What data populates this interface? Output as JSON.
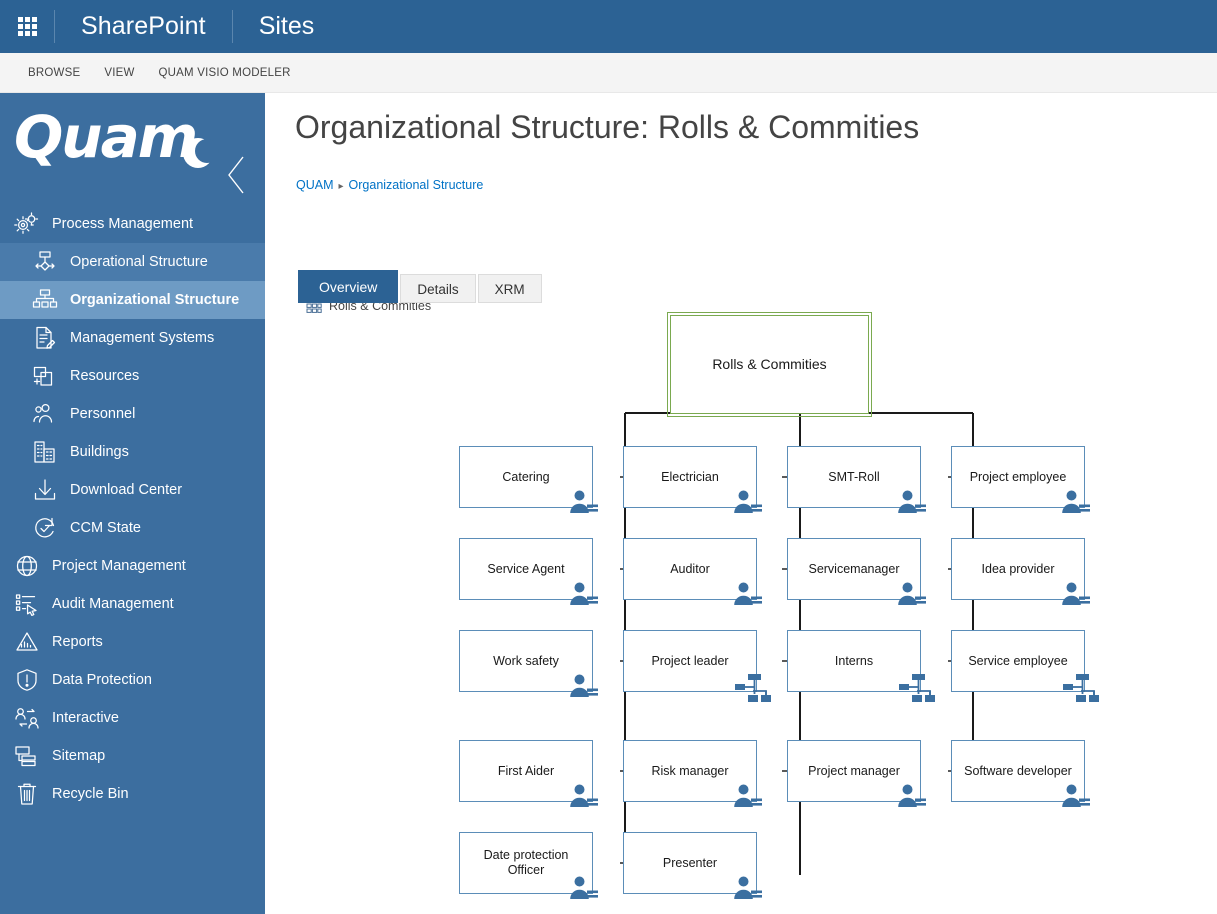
{
  "suitebar": {
    "waffle_icon": "app-launcher-icon",
    "brand": "SharePoint",
    "site": "Sites"
  },
  "ribbon": {
    "tabs": [
      {
        "label": "BROWSE"
      },
      {
        "label": "VIEW"
      },
      {
        "label": "QUAM VISIO MODELER"
      }
    ]
  },
  "sidebar": {
    "logo_text": "Quam",
    "logo_icon": "quam-moon-logo-icon",
    "collapse_icon": "chevron-left-icon",
    "items": [
      {
        "label": "Process Management",
        "icon": "gears-icon",
        "level": "top",
        "state": "normal"
      },
      {
        "label": "Operational Structure",
        "icon": "flow-chart-icon",
        "level": "sub",
        "state": "active-soft"
      },
      {
        "label": "Organizational Structure",
        "icon": "org-chart-icon",
        "level": "sub",
        "state": "active-strong"
      },
      {
        "label": "Management Systems",
        "icon": "document-edit-icon",
        "level": "sub",
        "state": "normal"
      },
      {
        "label": "Resources",
        "icon": "resources-icon",
        "level": "sub",
        "state": "normal"
      },
      {
        "label": "Personnel",
        "icon": "people-icon",
        "level": "sub",
        "state": "normal"
      },
      {
        "label": "Buildings",
        "icon": "building-icon",
        "level": "sub",
        "state": "normal"
      },
      {
        "label": "Download Center",
        "icon": "download-icon",
        "level": "sub",
        "state": "normal"
      },
      {
        "label": "CCM State",
        "icon": "check-cycle-icon",
        "level": "sub",
        "state": "normal"
      },
      {
        "label": "Project Management",
        "icon": "globe-icon",
        "level": "top",
        "state": "normal"
      },
      {
        "label": "Audit Management",
        "icon": "checklist-cursor-icon",
        "level": "top",
        "state": "normal"
      },
      {
        "label": "Reports",
        "icon": "chart-mountain-icon",
        "level": "top",
        "state": "normal"
      },
      {
        "label": "Data Protection",
        "icon": "shield-alert-icon",
        "level": "top",
        "state": "normal"
      },
      {
        "label": "Interactive",
        "icon": "people-exchange-icon",
        "level": "top",
        "state": "normal"
      },
      {
        "label": "Sitemap",
        "icon": "sitemap-icon",
        "level": "top",
        "state": "normal"
      },
      {
        "label": "Recycle Bin",
        "icon": "trash-icon",
        "level": "top",
        "state": "normal"
      }
    ]
  },
  "main": {
    "page_title": "Organizational Structure: Rolls & Commities",
    "breadcrumb": {
      "root": "QUAM",
      "separator": "▸",
      "parent": "Organizational Structure",
      "leaf": "Rolls & Commities",
      "leaf_icon": "org-chart-small-icon"
    },
    "tabs": [
      {
        "label": "Overview",
        "selected": true
      },
      {
        "label": "Details",
        "selected": false
      },
      {
        "label": "XRM",
        "selected": false
      }
    ]
  },
  "chart_data": {
    "type": "diagram",
    "title": "Rolls & Commities",
    "root": {
      "label": "Rolls & Commities",
      "border_color": "#7aa94f"
    },
    "node_border_color": "#5b8db8",
    "connector_color": "#1a1a1a",
    "badge_color": "#3b6fa0",
    "columns": [
      {
        "name": "column-1",
        "nodes": [
          {
            "label": "Catering",
            "badge": "person-icon"
          },
          {
            "label": "Service Agent",
            "badge": "person-icon"
          },
          {
            "label": "Work safety",
            "badge": "person-icon"
          },
          {
            "label": "First Aider",
            "badge": "person-icon"
          },
          {
            "label": "Date protection Officer",
            "badge": "person-icon"
          }
        ]
      },
      {
        "name": "column-2",
        "nodes": [
          {
            "label": "Electrician",
            "badge": "person-icon"
          },
          {
            "label": "Auditor",
            "badge": "person-icon"
          },
          {
            "label": "Project leader",
            "badge": "hierarchy-icon"
          },
          {
            "label": "Risk manager",
            "badge": "person-icon"
          },
          {
            "label": "Presenter",
            "badge": "person-icon"
          }
        ]
      },
      {
        "name": "column-3",
        "nodes": [
          {
            "label": "SMT-Roll",
            "badge": "person-icon"
          },
          {
            "label": "Servicemanager",
            "badge": "person-icon"
          },
          {
            "label": "Interns",
            "badge": "hierarchy-icon"
          },
          {
            "label": "Project manager",
            "badge": "person-icon"
          }
        ]
      },
      {
        "name": "column-4",
        "nodes": [
          {
            "label": "Project employee",
            "badge": "person-icon"
          },
          {
            "label": "Idea provider",
            "badge": "person-icon"
          },
          {
            "label": "Service employee",
            "badge": "hierarchy-icon"
          },
          {
            "label": "Software developer",
            "badge": "person-icon"
          }
        ]
      }
    ]
  }
}
